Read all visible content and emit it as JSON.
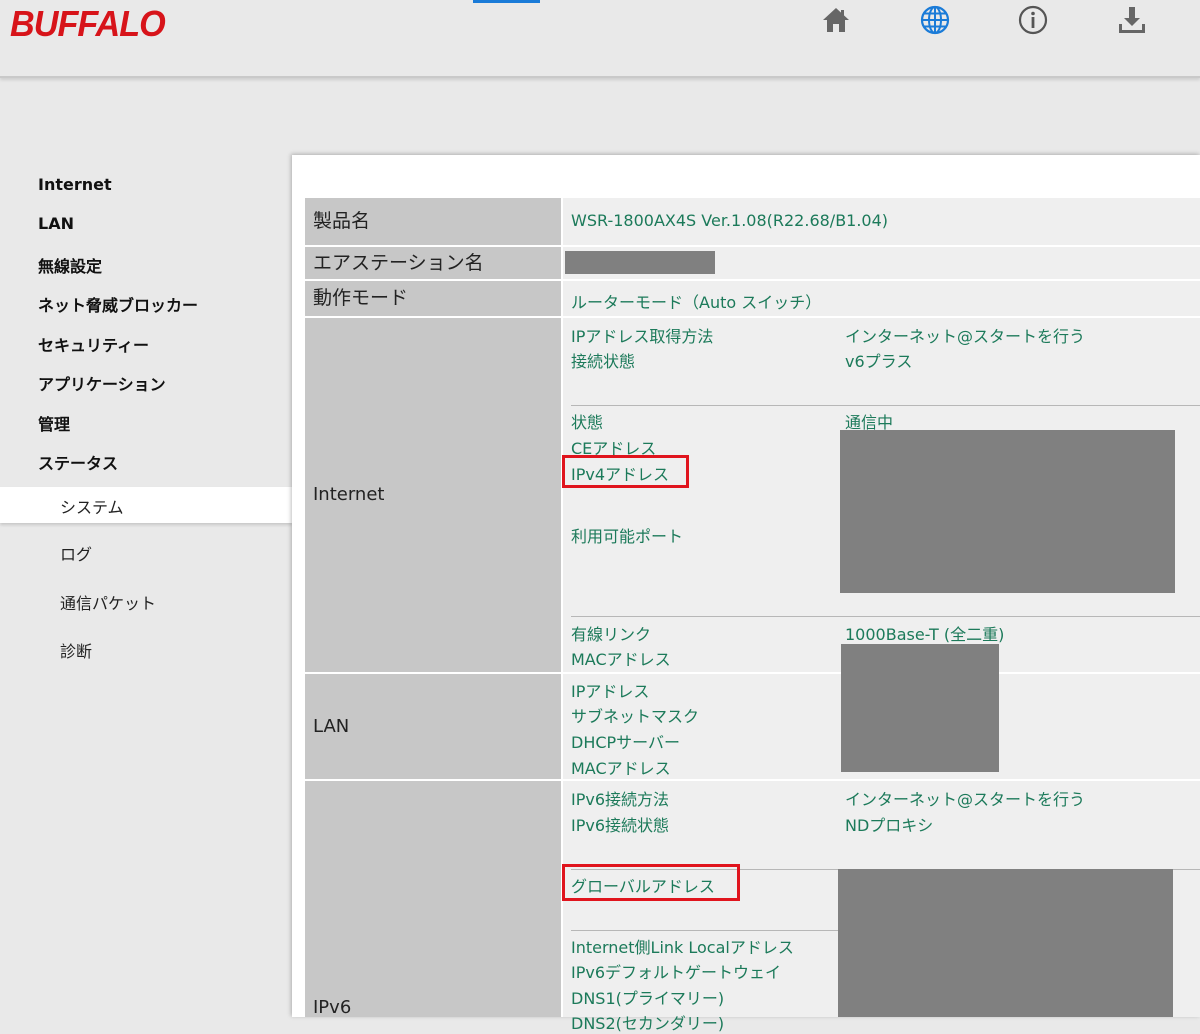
{
  "brand": {
    "logo": "BUFFALO",
    "color": "#d7141a"
  },
  "header_icons": [
    "home-icon",
    "globe-icon",
    "info-icon",
    "download-icon"
  ],
  "sidebar": {
    "items": [
      "Internet",
      "LAN",
      "無線設定",
      "ネット脅威ブロッカー",
      "セキュリティー",
      "アプリケーション",
      "管理",
      "ステータス"
    ],
    "sub_items": [
      "システム",
      "ログ",
      "通信パケット",
      "診断"
    ],
    "active_sub": "システム"
  },
  "table": {
    "product_label": "製品名",
    "product_value": "WSR-1800AX4S Ver.1.08(R22.68/B1.04)",
    "station_label": "エアステーション名",
    "mode_label": "動作モード",
    "mode_value": "ルーターモード（Auto スイッチ）",
    "internet": {
      "label": "Internet",
      "ip_method_label": "IPアドレス取得方法",
      "ip_method_value": "インターネット@スタートを行う",
      "conn_label": "接続状態",
      "conn_value": "v6プラス",
      "status_label": "状態",
      "status_value": "通信中",
      "ce_label": "CEアドレス",
      "ipv4_label": "IPv4アドレス",
      "ports_label": "利用可能ポート",
      "link_label": "有線リンク",
      "link_value": "1000Base-T (全二重)",
      "mac_label": "MACアドレス"
    },
    "lan": {
      "label": "LAN",
      "ip_label": "IPアドレス",
      "mask_label": "サブネットマスク",
      "dhcp_label": "DHCPサーバー",
      "mac_label": "MACアドレス"
    },
    "ipv6": {
      "label": "IPv6",
      "method_label": "IPv6接続方法",
      "method_value": "インターネット@スタートを行う",
      "state_label": "IPv6接続状態",
      "state_value": "NDプロキシ",
      "global_label": "グローバルアドレス",
      "linklocal_label": "Internet側Link Localアドレス",
      "gateway_label": "IPv6デフォルトゲートウェイ",
      "dns1_label": "DNS1(プライマリー)",
      "dns2_label": "DNS2(セカンダリー)"
    }
  },
  "colors": {
    "accent_blue": "#1a7bd8",
    "value_green": "#1c7a5a",
    "highlight_red": "#e0141d"
  }
}
